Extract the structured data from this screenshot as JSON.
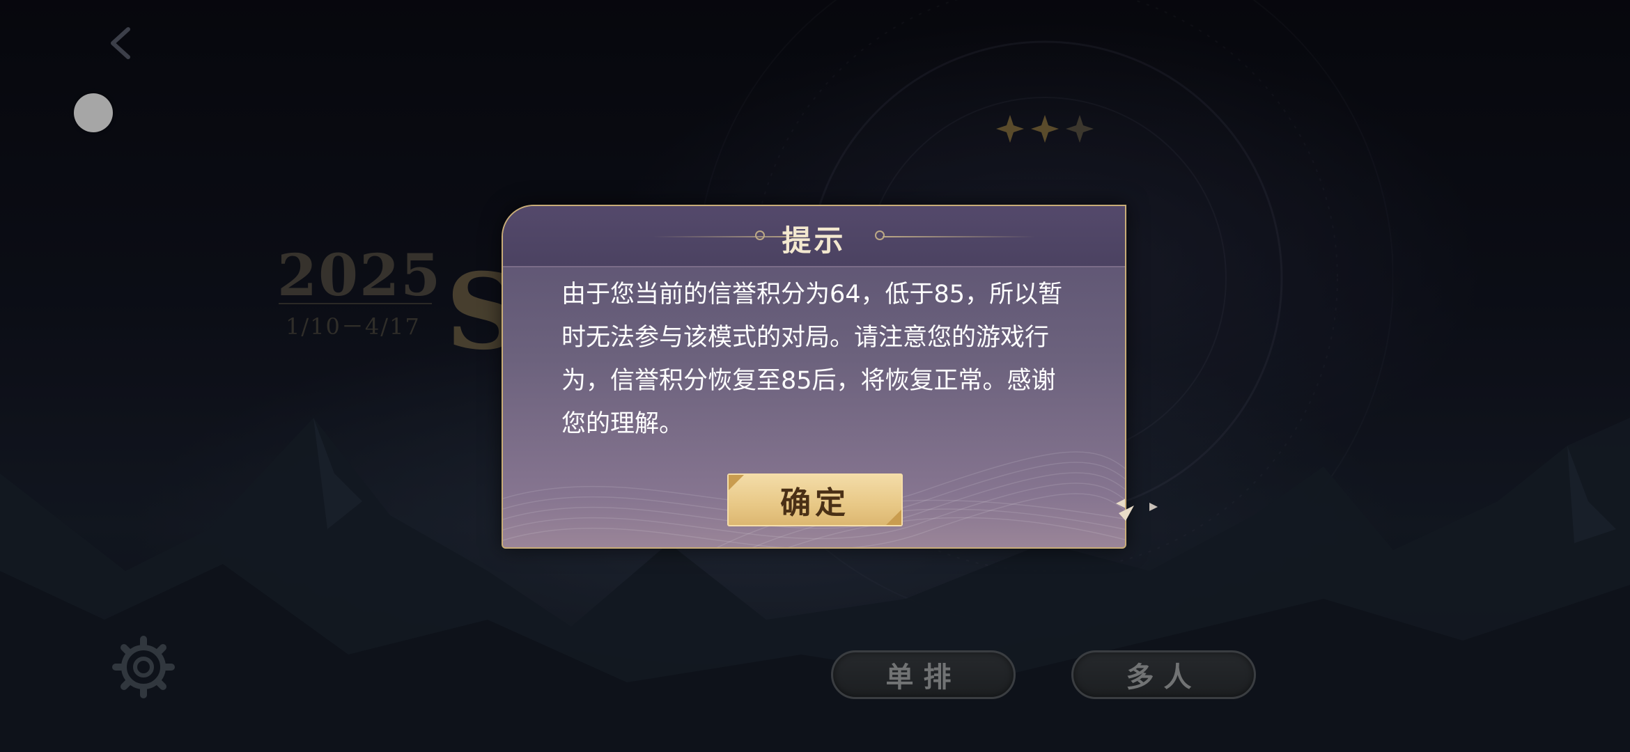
{
  "dialog": {
    "title": "提示",
    "message": "由于您当前的信誉积分为64，低于85，所以暂时无法参与该模式的对局。请注意您的游戏行为，信誉积分恢复至85后，将恢复正常。感谢您的理解。",
    "confirm_label": "确定"
  },
  "season": {
    "year": "2025",
    "dates": "1/10－4/17",
    "letter": "S"
  },
  "modes": {
    "solo_label": "单排",
    "multi_label": "多人"
  },
  "icons": {
    "back": "back-arrow-icon",
    "floating": "floating-assistant-dot",
    "settings": "gear-icon",
    "stars": "three-stars-icon"
  },
  "colors": {
    "dialog_border": "#c9ad78",
    "confirm_gold": "#e8c886",
    "title_text": "#f3e8cf"
  }
}
